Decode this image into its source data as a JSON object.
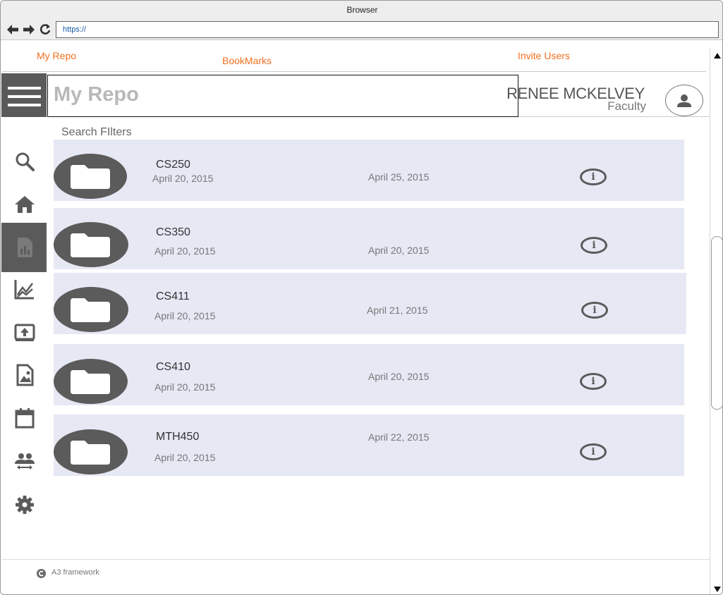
{
  "browser": {
    "title": "Browser",
    "url": "https://"
  },
  "top_links": {
    "my_repo": "My Repo",
    "bookmarks": "BookMarks",
    "invite_users": "Invite Users"
  },
  "header": {
    "title": "My Repo",
    "user_name": "RENEE MCKELVEY",
    "user_role": "Faculty"
  },
  "sidebar": {
    "items": [
      {
        "icon": "search-icon"
      },
      {
        "icon": "home-icon"
      },
      {
        "icon": "report-icon",
        "active": true
      },
      {
        "icon": "chart-icon"
      },
      {
        "icon": "upload-icon"
      },
      {
        "icon": "image-file-icon"
      },
      {
        "icon": "calendar-icon"
      },
      {
        "icon": "people-swap-icon"
      },
      {
        "icon": "gear-icon"
      }
    ]
  },
  "search": {
    "label": "Search FIlters"
  },
  "repos": [
    {
      "name": "CS250",
      "created": "April 20, 2015",
      "modified": "April 25, 2015"
    },
    {
      "name": "CS350",
      "created": "April 20, 2015",
      "modified": "April 20, 2015"
    },
    {
      "name": "CS411",
      "created": "April 20, 2015",
      "modified": "April 21, 2015"
    },
    {
      "name": "CS410",
      "created": "April 20, 2015",
      "modified": "April 20, 2015"
    },
    {
      "name": "MTH450",
      "created": "April 20, 2015",
      "modified": "April 22, 2015"
    }
  ],
  "info_glyph": "i",
  "footer": {
    "text": "A3 framework"
  },
  "colors": {
    "accent": "#f0701f",
    "row_bg": "#e6e8f4",
    "dark_gray": "#5a5a5a"
  }
}
